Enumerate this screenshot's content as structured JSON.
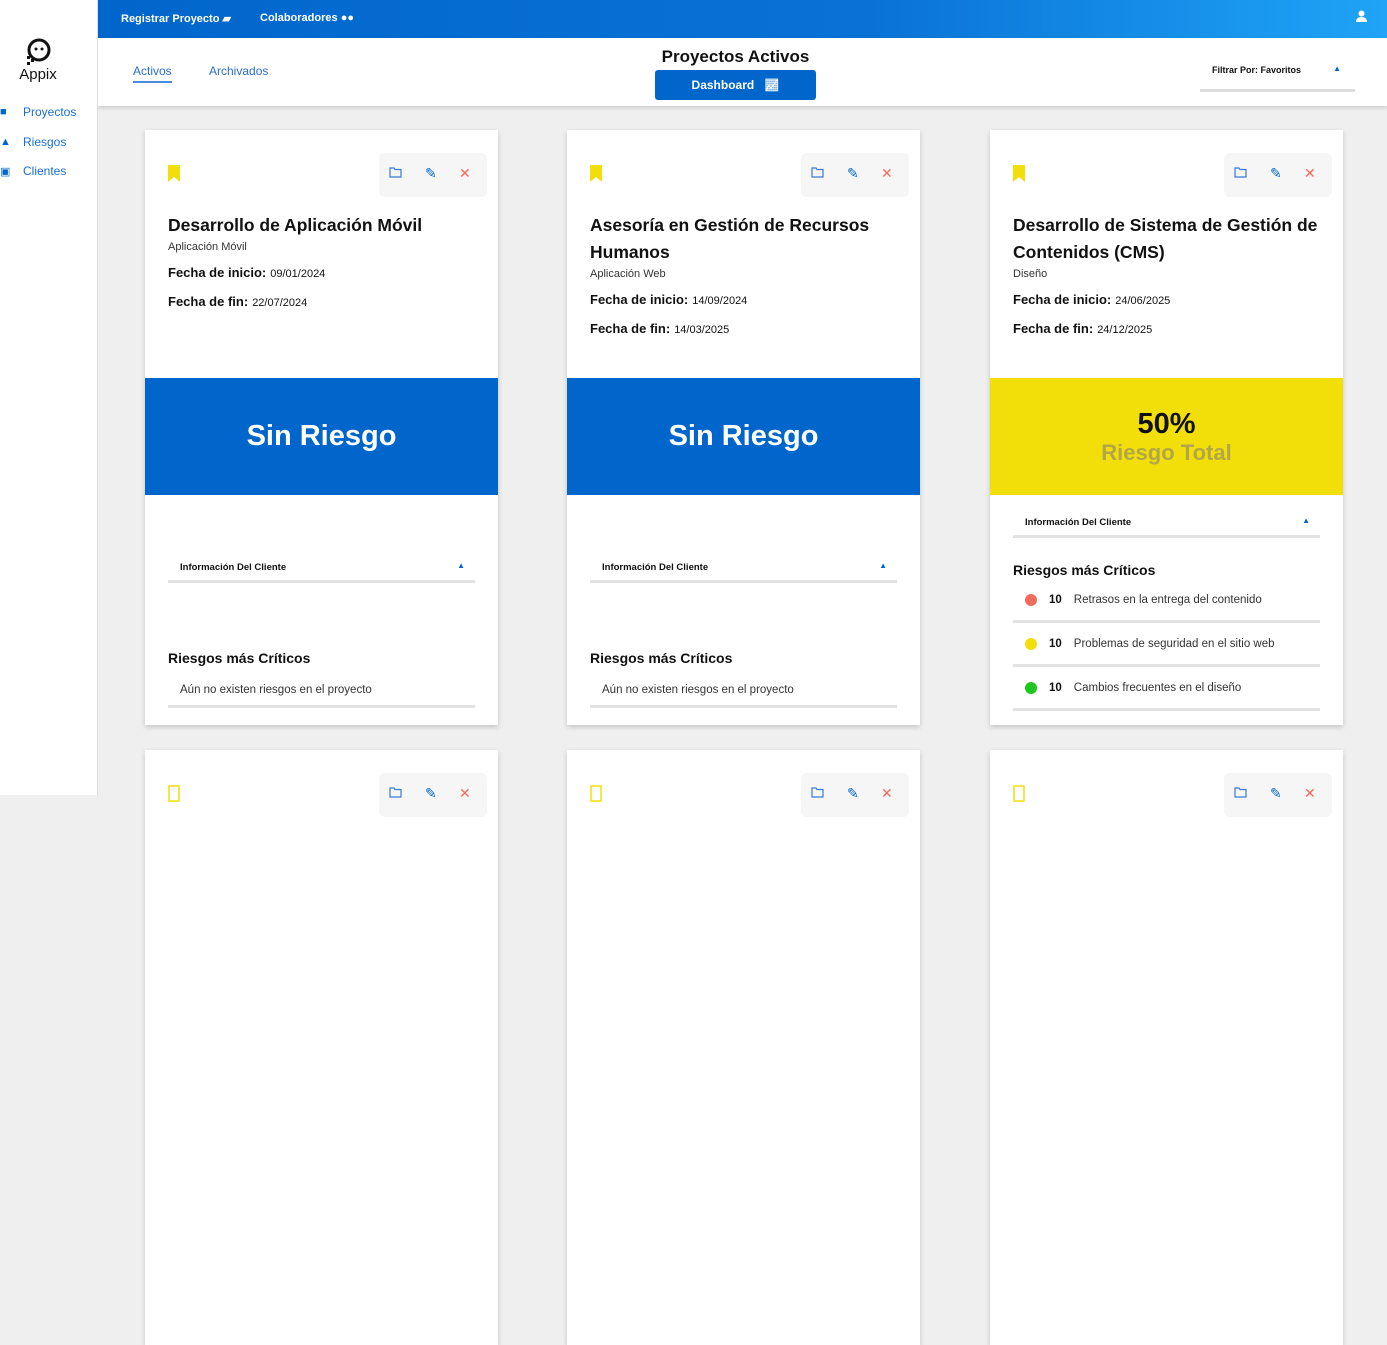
{
  "sidebar": {
    "logo": "Appix",
    "items": [
      {
        "label": "Proyectos",
        "icon": "folder-icon"
      },
      {
        "label": "Riesgos",
        "icon": "warning-icon"
      },
      {
        "label": "Clientes",
        "icon": "contact-book-icon"
      }
    ]
  },
  "topbar": {
    "register": "Registrar Proyecto",
    "register_icon": "folder-open-icon",
    "collab": "Colaboradores",
    "collab_icon": "users-icon",
    "user_icon": "user-icon"
  },
  "subheader": {
    "tabs": [
      "Activos",
      "Archivados"
    ],
    "active_tab": "Activos",
    "title": "Proyectos Activos",
    "dashboard": "Dashboard",
    "filter": "Filtrar Por: Favoritos"
  },
  "labels": {
    "start": "Fecha de inicio:",
    "end": "Fecha de fin:",
    "info": "Información Del Cliente",
    "critical": "Riesgos más Críticos",
    "no_risks": "Aún no existen riesgos en el proyecto",
    "no_risk_band": "Sin Riesgo",
    "total_risk": "Riesgo Total"
  },
  "colors": {
    "primary": "#0066cc",
    "favorite": "#f2df0a",
    "risk_high": "#f26b5b",
    "risk_mid": "#f2df0a",
    "risk_low": "#1ec61e",
    "delete": "#f26b5b"
  },
  "cards": [
    {
      "title": "Desarrollo de Aplicación Móvil",
      "type": "Aplicación Móvil",
      "start": "09/01/2024",
      "end": "22/07/2024",
      "favorite": true,
      "risk": null,
      "risks": []
    },
    {
      "title": "Asesoría en Gestión de Recursos Humanos",
      "type": "Aplicación Web",
      "start": "14/09/2024",
      "end": "14/03/2025",
      "favorite": true,
      "risk": null,
      "risks": []
    },
    {
      "title": "Desarrollo de Sistema de Gestión de Contenidos (CMS)",
      "type": "Diseño",
      "start": "24/06/2025",
      "end": "24/12/2025",
      "favorite": true,
      "risk": "50%",
      "risks": [
        {
          "score": "10",
          "label": "Retrasos en la entrega del contenido",
          "level": "high"
        },
        {
          "score": "10",
          "label": "Problemas de seguridad en el sitio web",
          "level": "mid"
        },
        {
          "score": "10",
          "label": "Cambios frecuentes en el diseño",
          "level": "low"
        }
      ]
    },
    {
      "favorite": false
    },
    {
      "favorite": false
    },
    {
      "favorite": false
    }
  ]
}
